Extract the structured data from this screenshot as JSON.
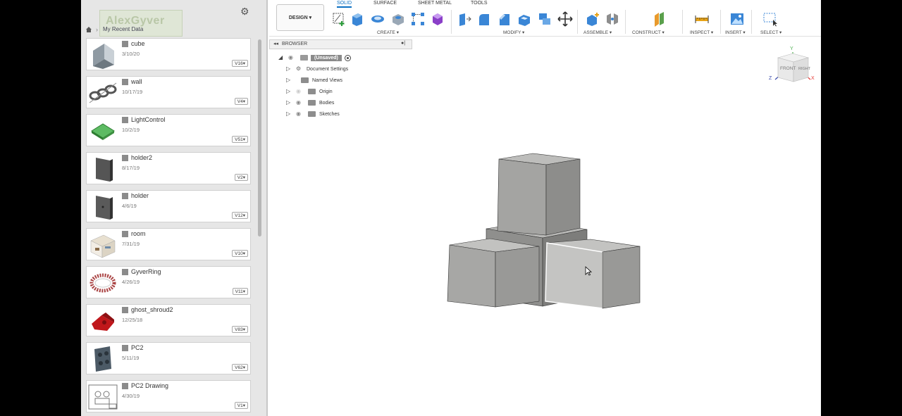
{
  "data_panel": {
    "logo_text": "AlexGyver",
    "breadcrumb": "My Recent Data",
    "files": [
      {
        "name": "cube",
        "date": "3/10/20",
        "version": "V16▾",
        "thumb": "cube-thumb"
      },
      {
        "name": "wall",
        "date": "10/17/19",
        "version": "V4▾",
        "thumb": "chain-thumb"
      },
      {
        "name": "LightControl",
        "date": "10/2/19",
        "version": "V51▾",
        "thumb": "pcb-thumb"
      },
      {
        "name": "holder2",
        "date": "8/17/19",
        "version": "V2▾",
        "thumb": "holder-thumb"
      },
      {
        "name": "holder",
        "date": "4/6/19",
        "version": "V12▾",
        "thumb": "holder-thumb"
      },
      {
        "name": "room",
        "date": "7/31/19",
        "version": "V10▾",
        "thumb": "room-thumb"
      },
      {
        "name": "GyverRing",
        "date": "4/26/19",
        "version": "V11▾",
        "thumb": "ring-thumb"
      },
      {
        "name": "ghost_shroud2",
        "date": "12/25/18",
        "version": "V83▾",
        "thumb": "shroud-thumb"
      },
      {
        "name": "PC2",
        "date": "5/11/19",
        "version": "V62▾",
        "thumb": "pc-thumb"
      },
      {
        "name": "PC2 Drawing",
        "date": "4/30/19",
        "version": "V1▾",
        "thumb": "drawing-thumb"
      }
    ]
  },
  "toolbar": {
    "design_label": "DESIGN ▾",
    "tabs": [
      "SOLID",
      "SURFACE",
      "SHEET METAL",
      "TOOLS"
    ],
    "active_tab": "SOLID",
    "groups": {
      "create": "CREATE ▾",
      "modify": "MODIFY ▾",
      "assemble": "ASSEMBLE ▾",
      "construct": "CONSTRUCT ▾",
      "inspect": "INSPECT ▾",
      "insert": "INSERT ▾",
      "select": "SELECT ▾"
    }
  },
  "browser": {
    "title": "BROWSER",
    "root": "(Unsaved)",
    "items": [
      "Document Settings",
      "Named Views",
      "Origin",
      "Bodies",
      "Sketches"
    ]
  },
  "viewcube": {
    "front": "FRONT",
    "right": "RIGHT",
    "axis_x": "X",
    "axis_y": "Y",
    "axis_z": "Z"
  },
  "colors": {
    "accent": "#0a6fc2",
    "model_face": "#a7a7a5",
    "panel": "#e6e6e6"
  }
}
